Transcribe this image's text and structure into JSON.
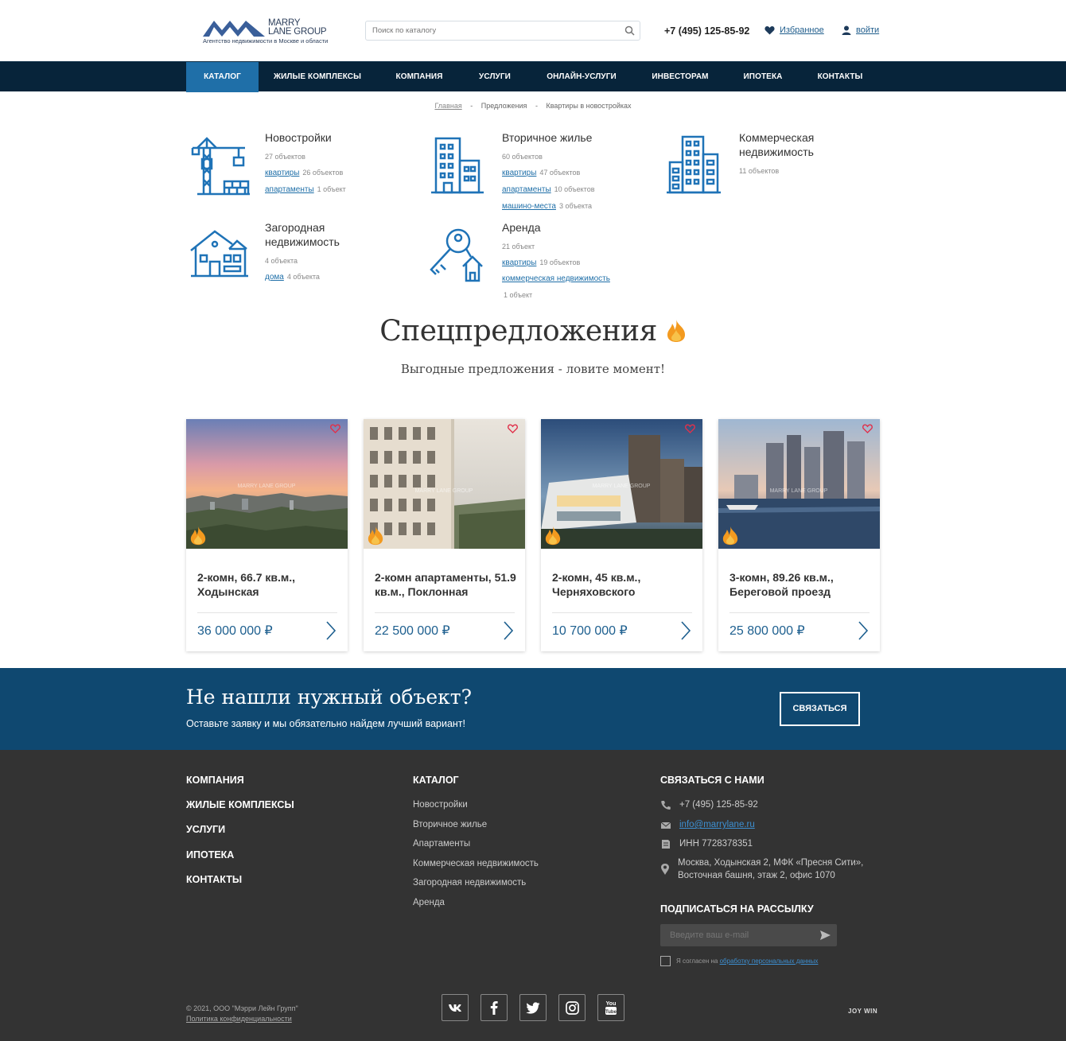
{
  "header": {
    "logo_line1": "MARRY",
    "logo_line2": "LANE GROUP",
    "logo_sub": "Агентство недвижимости в Москве и области",
    "search_placeholder": "Поиск по каталогу",
    "phone": "+7 (495) 125-85-92",
    "favorites": "Избранное",
    "login": "войти"
  },
  "nav": {
    "items": [
      "КАТАЛОГ",
      "ЖИЛЫЕ КОМПЛЕКСЫ",
      "КОМПАНИЯ",
      "УСЛУГИ",
      "ОНЛАЙН-УСЛУГИ",
      "ИНВЕСТОРАМ",
      "ИПОТЕКА",
      "КОНТАКТЫ"
    ]
  },
  "breadcrumb": {
    "home": "Главная",
    "sep": "-",
    "level2": "Предложения",
    "current": "Квартиры в новостройках"
  },
  "categories": {
    "new": {
      "title": "Новостройки",
      "count": "27 объектов",
      "links": [
        {
          "label": "квартиры",
          "n": "26 объектов"
        },
        {
          "label": "апартаменты",
          "n": "1 объект"
        }
      ]
    },
    "secondary": {
      "title": "Вторичное жилье",
      "count": "60 объектов",
      "links": [
        {
          "label": "квартиры",
          "n": "47 объектов"
        },
        {
          "label": "апартаменты",
          "n": "10 объектов"
        },
        {
          "label": "машино-места",
          "n": "3 объекта"
        }
      ]
    },
    "commercial": {
      "title": "Коммерческая недвижимость",
      "count": "11 объектов"
    },
    "country": {
      "title": "Загородная недвижимость",
      "count": "4 объекта",
      "links": [
        {
          "label": "дома",
          "n": "4 объекта"
        }
      ]
    },
    "rent": {
      "title": "Аренда",
      "count": "21 объект",
      "links": [
        {
          "label": "квартиры",
          "n": "19 объектов"
        },
        {
          "label": "коммерческая недвижимость",
          "n": "1 объект"
        }
      ]
    }
  },
  "offers": {
    "title": "Спецпредложения",
    "subtitle": "Выгодные предложения - ловите момент!",
    "watermark": "MARRY LANE GROUP",
    "cards": [
      {
        "title": "2-комн, 66.7 кв.м., Ходынская",
        "price": "36 000 000 ₽"
      },
      {
        "title": "2-комн апартаменты, 51.9 кв.м., Поклонная",
        "price": "22 500 000 ₽"
      },
      {
        "title": "2-комн, 45 кв.м., Черняховского",
        "price": "10 700 000 ₽"
      },
      {
        "title": "3-комн, 89.26 кв.м., Береговой проезд",
        "price": "25 800 000 ₽"
      }
    ]
  },
  "cta": {
    "title": "Не нашли нужный объект?",
    "text": "Оставьте заявку и мы обязательно найдем лучший вариант!",
    "button": "СВЯЗАТЬСЯ"
  },
  "footer": {
    "menu": [
      "КОМПАНИЯ",
      "ЖИЛЫЕ КОМПЛЕКСЫ",
      "УСЛУГИ",
      "ИПОТЕКА",
      "КОНТАКТЫ"
    ],
    "catalog_title": "КАТАЛОГ",
    "catalog": [
      "Новостройки",
      "Вторичное жилье",
      "Апартаменты",
      "Коммерческая недвижимость",
      "Загородная недвижимость",
      "Аренда"
    ],
    "contact_title": "СВЯЗАТЬСЯ С НАМИ",
    "phone": "+7 (495) 125-85-92",
    "email": "info@marrylane.ru",
    "inn": "ИНН 7728378351",
    "address_line1": "Москва, Ходынская 2, МФК «Пресня Сити»,",
    "address_line2": "Восточная башня, этаж 2, офис 1070",
    "subscribe_title": "ПОДПИСАТЬСЯ НА РАССЫЛКУ",
    "email_placeholder": "Введите ваш e-mail",
    "agree_text": "Я согласен на",
    "agree_link": "обработку персональных данных",
    "copyright": "© 2021, ООО \"Мэрри Лейн Групп\"",
    "privacy": "Политика конфиденциальности",
    "dev": "JOY WIN"
  },
  "colors": {
    "nav_bg": "#07243a",
    "accent": "#1f6fa8",
    "cta_bg": "#0f4870",
    "footer_bg": "#333333"
  }
}
